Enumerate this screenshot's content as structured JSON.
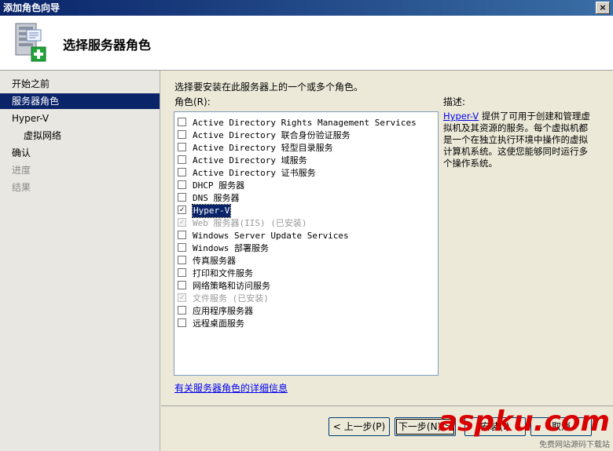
{
  "window": {
    "title": "添加角色向导",
    "close_label": "×"
  },
  "header": {
    "title": "选择服务器角色",
    "icon": "server-add-role-icon"
  },
  "nav": {
    "items": [
      {
        "label": "开始之前",
        "state": "normal",
        "sub": false
      },
      {
        "label": "服务器角色",
        "state": "active",
        "sub": false
      },
      {
        "label": "Hyper-V",
        "state": "normal",
        "sub": false
      },
      {
        "label": "虚拟网络",
        "state": "normal",
        "sub": true
      },
      {
        "label": "确认",
        "state": "normal",
        "sub": false
      },
      {
        "label": "进度",
        "state": "disabled",
        "sub": false
      },
      {
        "label": "结果",
        "state": "disabled",
        "sub": false
      }
    ]
  },
  "main": {
    "instruction": "选择要安装在此服务器上的一个或多个角色。",
    "roles_label": "角色(R):",
    "roles": [
      {
        "label": "Active Directory Rights Management Services",
        "checked": false,
        "disabled": false
      },
      {
        "label": "Active Directory 联合身份验证服务",
        "checked": false,
        "disabled": false
      },
      {
        "label": "Active Directory 轻型目录服务",
        "checked": false,
        "disabled": false
      },
      {
        "label": "Active Directory 域服务",
        "checked": false,
        "disabled": false
      },
      {
        "label": "Active Directory 证书服务",
        "checked": false,
        "disabled": false
      },
      {
        "label": "DHCP 服务器",
        "checked": false,
        "disabled": false
      },
      {
        "label": "DNS 服务器",
        "checked": false,
        "disabled": false
      },
      {
        "label": "Hyper-V",
        "checked": true,
        "disabled": false,
        "selected": true
      },
      {
        "label": "Web 服务器(IIS)  (已安装)",
        "checked": true,
        "disabled": true
      },
      {
        "label": "Windows Server Update Services",
        "checked": false,
        "disabled": false
      },
      {
        "label": "Windows 部署服务",
        "checked": false,
        "disabled": false
      },
      {
        "label": "传真服务器",
        "checked": false,
        "disabled": false
      },
      {
        "label": "打印和文件服务",
        "checked": false,
        "disabled": false
      },
      {
        "label": "网络策略和访问服务",
        "checked": false,
        "disabled": false
      },
      {
        "label": "文件服务  (已安装)",
        "checked": true,
        "disabled": true
      },
      {
        "label": "应用程序服务器",
        "checked": false,
        "disabled": false
      },
      {
        "label": "远程桌面服务",
        "checked": false,
        "disabled": false
      }
    ],
    "description_label": "描述:",
    "description_link": "Hyper-V",
    "description_text": " 提供了可用于创建和管理虚拟机及其资源的服务。每个虚拟机都是一个在独立执行环境中操作的虚拟计算机系统。这使您能够同时运行多个操作系统。",
    "more_info_link": "有关服务器角色的详细信息"
  },
  "buttons": {
    "back": "< 上一步(P)",
    "next": "下一步(N) >",
    "install": "安装(I)",
    "cancel": "取消"
  },
  "watermark": {
    "main": "aspku.com",
    "sub": "免费网站源码下载站"
  }
}
